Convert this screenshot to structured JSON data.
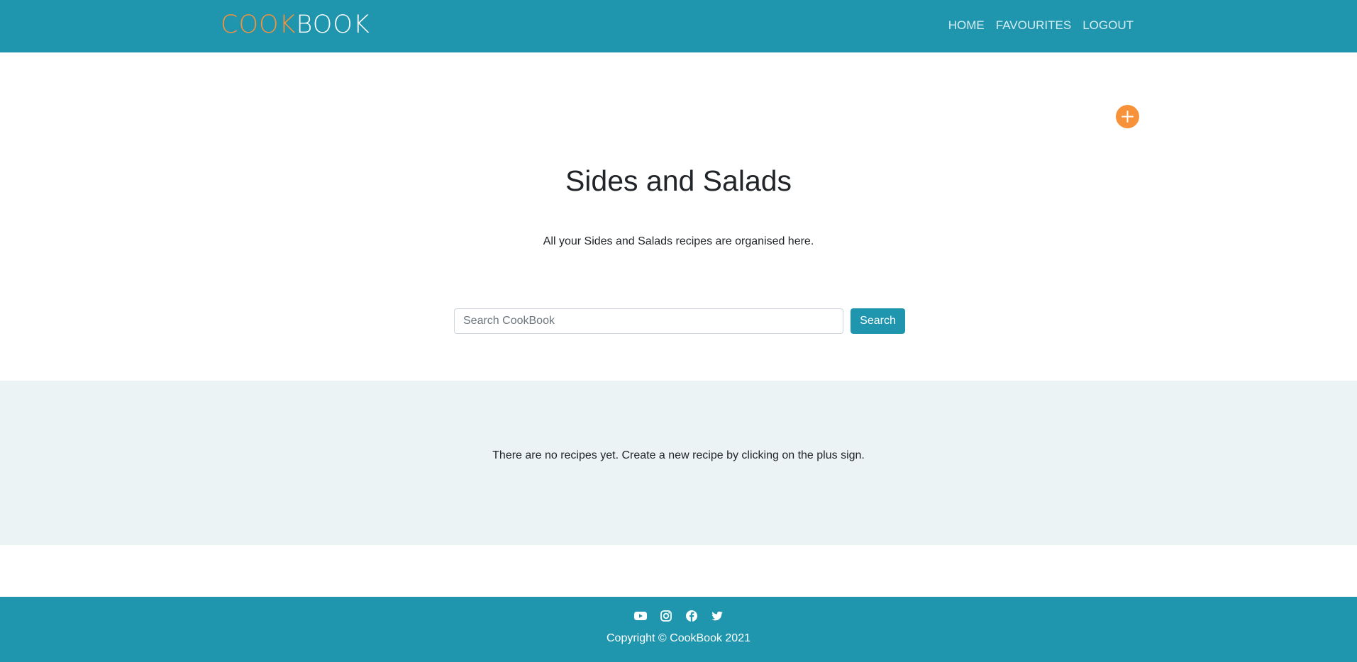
{
  "brand": {
    "part1": "COOK",
    "part2": "BOOK"
  },
  "nav": {
    "home": "HOME",
    "favourites": "FAVOURITES",
    "logout": "LOGOUT"
  },
  "colors": {
    "primary": "#1f95ae",
    "accent": "#f7923a",
    "section_bg": "#ebf3f5"
  },
  "add_button": {
    "icon": "plus-icon"
  },
  "page": {
    "title": "Sides and Salads",
    "subtitle": "All your Sides and Salads recipes are organised here."
  },
  "search": {
    "placeholder": "Search CookBook",
    "value": "",
    "button_label": "Search"
  },
  "recipes": {
    "empty_message": "There are no recipes yet. Create a new recipe by clicking on the plus sign."
  },
  "footer": {
    "social_icons": [
      "youtube-icon",
      "instagram-icon",
      "facebook-icon",
      "twitter-icon"
    ],
    "copyright": "Copyright © CookBook 2021"
  }
}
